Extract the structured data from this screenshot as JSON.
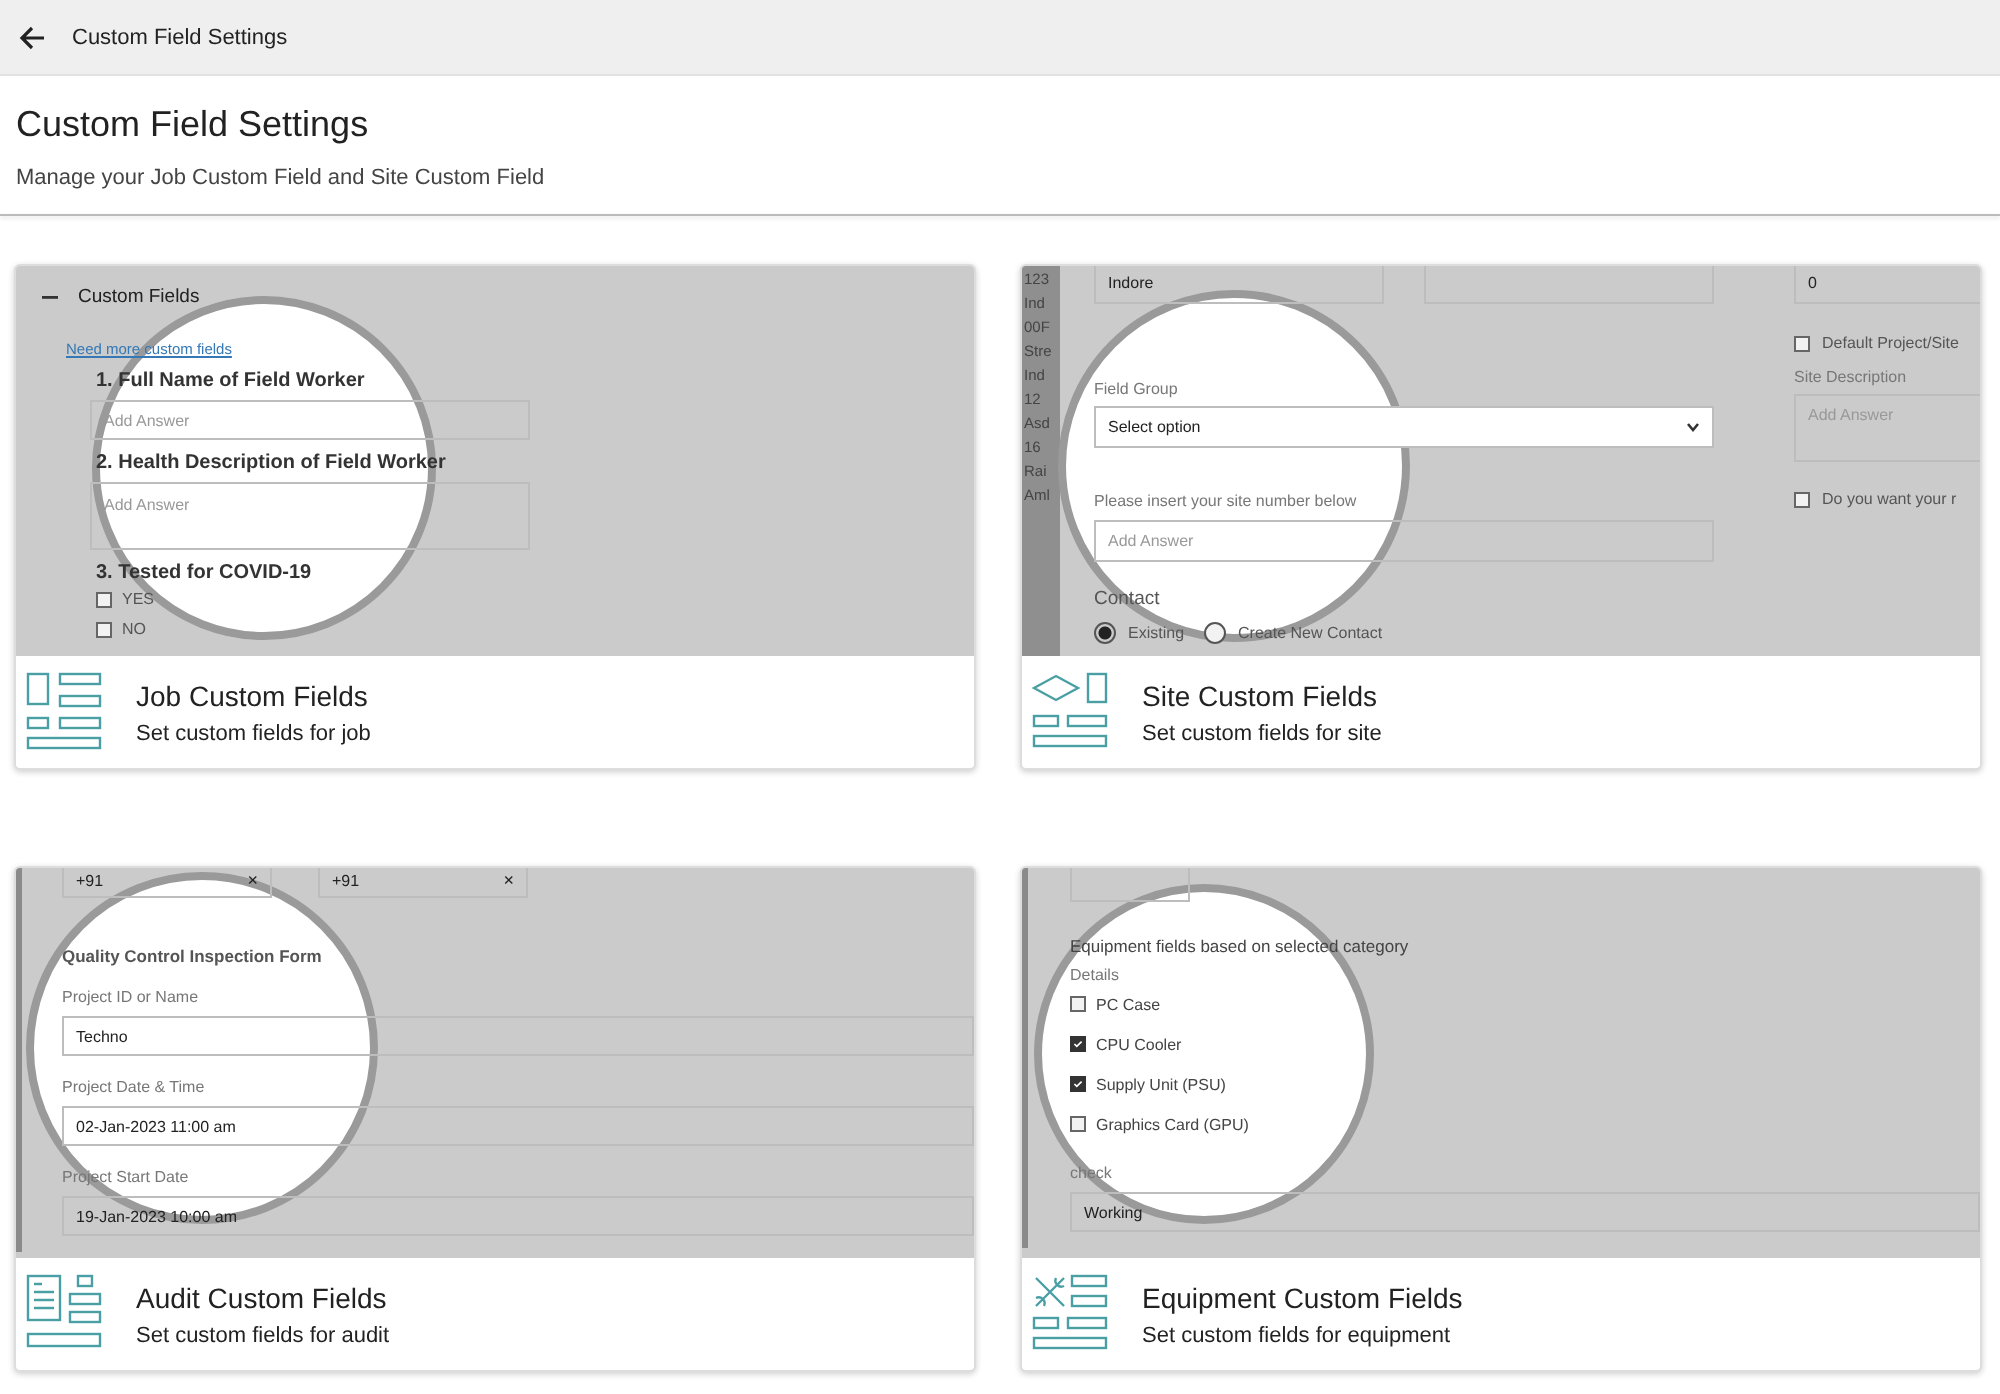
{
  "header": {
    "title": "Custom Field Settings"
  },
  "page": {
    "title": "Custom Field Settings",
    "subtitle": "Manage your Job Custom Field and Site Custom Field"
  },
  "cards": [
    {
      "kind": "job",
      "title": "Job Custom Fields",
      "description": "Set custom fields for job",
      "preview": {
        "section": "Custom Fields",
        "link": "Need more custom fields",
        "questions": [
          {
            "kind": "input",
            "label": "1. Full Name of Field Worker",
            "placeholder": "Add Answer"
          },
          {
            "kind": "textarea",
            "label": "2. Health Description of Field Worker",
            "placeholder": "Add Answer"
          },
          {
            "kind": "checkboxes",
            "label": "3. Tested for COVID-19",
            "options": [
              {
                "label": "YES",
                "checked": false
              },
              {
                "label": "NO",
                "checked": false
              }
            ]
          }
        ]
      }
    },
    {
      "kind": "site",
      "title": "Site Custom Fields",
      "description": "Set custom fields for site",
      "preview": {
        "side_list": [
          "123",
          "Ind",
          "00F",
          "Stre",
          "Ind",
          "12",
          "Asd",
          "16",
          "Rai",
          "Aml"
        ],
        "city_value": "Indore",
        "field_group": {
          "label": "Field Group",
          "value": "Select option"
        },
        "site_number": {
          "label": "Please insert your site number below",
          "placeholder": "Add Answer"
        },
        "contact": {
          "label": "Contact",
          "options": [
            {
              "label": "Existing",
              "selected": true
            },
            {
              "label": "Create New Contact",
              "selected": false
            }
          ]
        },
        "number_value": "0",
        "default_option": {
          "label": "Default Project/Site",
          "checked": false
        },
        "description": {
          "label": "Site Description",
          "placeholder": "Add Answer"
        },
        "extra_option": {
          "label": "Do you want your r",
          "checked": false
        }
      }
    },
    {
      "kind": "audit",
      "title": "Audit Custom Fields",
      "description": "Set custom fields for audit",
      "preview": {
        "phones": [
          {
            "value": "+91",
            "clear": "×"
          },
          {
            "value": "+91",
            "clear": "×"
          }
        ],
        "form_title": "Quality Control Inspection Form",
        "fields": [
          {
            "label": "Project ID or Name",
            "value": "Techno"
          },
          {
            "label": "Project Date & Time",
            "value": "02-Jan-2023 11:00 am"
          },
          {
            "label": "Project Start Date",
            "value": "19-Jan-2023 10:00 am"
          }
        ]
      }
    },
    {
      "kind": "equipment",
      "title": "Equipment Custom Fields",
      "description": "Set custom fields for equipment",
      "preview": {
        "note": "Equipment fields based on selected category",
        "group": "Details",
        "options": [
          {
            "label": "PC Case",
            "checked": false
          },
          {
            "label": "CPU Cooler",
            "checked": true
          },
          {
            "label": "Supply Unit (PSU)",
            "checked": true
          },
          {
            "label": "Graphics Card (GPU)",
            "checked": false
          }
        ],
        "status": {
          "label": "check",
          "value": "Working"
        }
      }
    }
  ]
}
